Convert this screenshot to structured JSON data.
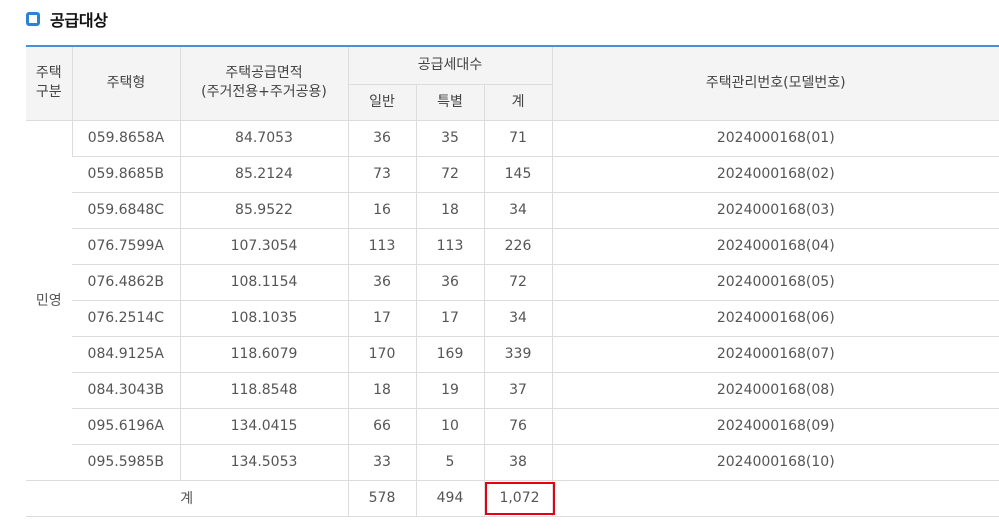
{
  "section": {
    "title": "공급대상",
    "icon": "square-bullet-icon",
    "accent_color": "#2f80d9"
  },
  "table": {
    "headers": {
      "category": "주택\n구분",
      "type": "주택형",
      "area": "주택공급면적\n(주거전용+주거공용)",
      "supply_units": "공급세대수",
      "general": "일반",
      "special": "특별",
      "subtotal": "계",
      "mgmt_no": "주택관리번호(모델번호)"
    },
    "category_value": "민영",
    "rows": [
      {
        "type": "059.8658A",
        "area": "84.7053",
        "general": "36",
        "special": "35",
        "total": "71",
        "mgmt_no": "2024000168(01)"
      },
      {
        "type": "059.8685B",
        "area": "85.2124",
        "general": "73",
        "special": "72",
        "total": "145",
        "mgmt_no": "2024000168(02)"
      },
      {
        "type": "059.6848C",
        "area": "85.9522",
        "general": "16",
        "special": "18",
        "total": "34",
        "mgmt_no": "2024000168(03)"
      },
      {
        "type": "076.7599A",
        "area": "107.3054",
        "general": "113",
        "special": "113",
        "total": "226",
        "mgmt_no": "2024000168(04)"
      },
      {
        "type": "076.4862B",
        "area": "108.1154",
        "general": "36",
        "special": "36",
        "total": "72",
        "mgmt_no": "2024000168(05)"
      },
      {
        "type": "076.2514C",
        "area": "108.1035",
        "general": "17",
        "special": "17",
        "total": "34",
        "mgmt_no": "2024000168(06)"
      },
      {
        "type": "084.9125A",
        "area": "118.6079",
        "general": "170",
        "special": "169",
        "total": "339",
        "mgmt_no": "2024000168(07)"
      },
      {
        "type": "084.3043B",
        "area": "118.8548",
        "general": "18",
        "special": "19",
        "total": "37",
        "mgmt_no": "2024000168(08)"
      },
      {
        "type": "095.6196A",
        "area": "134.0415",
        "general": "66",
        "special": "10",
        "total": "76",
        "mgmt_no": "2024000168(09)"
      },
      {
        "type": "095.5985B",
        "area": "134.5053",
        "general": "33",
        "special": "5",
        "total": "38",
        "mgmt_no": "2024000168(10)"
      }
    ],
    "total_row": {
      "label": "계",
      "general": "578",
      "special": "494",
      "total": "1,072",
      "highlight_color": "#e60012"
    }
  }
}
